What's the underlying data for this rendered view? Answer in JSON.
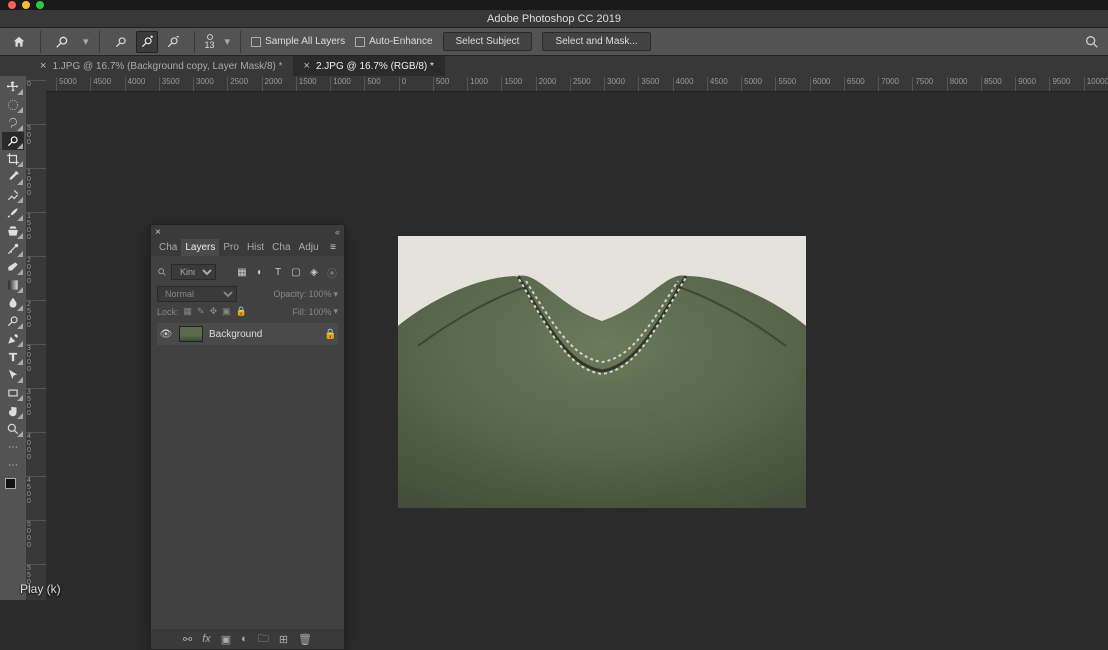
{
  "app": {
    "title": "Adobe Photoshop CC 2019"
  },
  "options": {
    "brush_size": "13",
    "sample_all_layers_label": "Sample All Layers",
    "auto_enhance_label": "Auto-Enhance",
    "select_subject_label": "Select Subject",
    "select_and_mask_label": "Select and Mask..."
  },
  "tabs": [
    {
      "label": "1.JPG @ 16.7% (Background copy, Layer Mask/8) *",
      "active": false
    },
    {
      "label": "2.JPG @ 16.7% (RGB/8) *",
      "active": true
    }
  ],
  "hruler": [
    "5000",
    "4500",
    "4000",
    "3500",
    "3000",
    "2500",
    "2000",
    "1500",
    "1000",
    "500",
    "0",
    "500",
    "1000",
    "1500",
    "2000",
    "2500",
    "3000",
    "3500",
    "4000",
    "4500",
    "5000",
    "5500",
    "6000",
    "6500",
    "7000",
    "7500",
    "8000",
    "8500",
    "9000",
    "9500",
    "10000"
  ],
  "vruler": [
    "0",
    "500",
    "1000",
    "1500",
    "2000",
    "2500",
    "3000",
    "3500",
    "4000",
    "4500",
    "5000",
    "5500"
  ],
  "panel": {
    "tabs": [
      "Cha",
      "Layers",
      "Pro",
      "Hist",
      "Cha",
      "Adju"
    ],
    "active_tab": "Layers",
    "kind_label": "Kind",
    "mode_label": "Normal",
    "opacity_label": "Opacity:",
    "opacity_value": "100%",
    "lock_label": "Lock:",
    "fill_label": "Fill:",
    "fill_value": "100%",
    "layer0_name": "Background"
  },
  "footer_tip": "Play (k)"
}
